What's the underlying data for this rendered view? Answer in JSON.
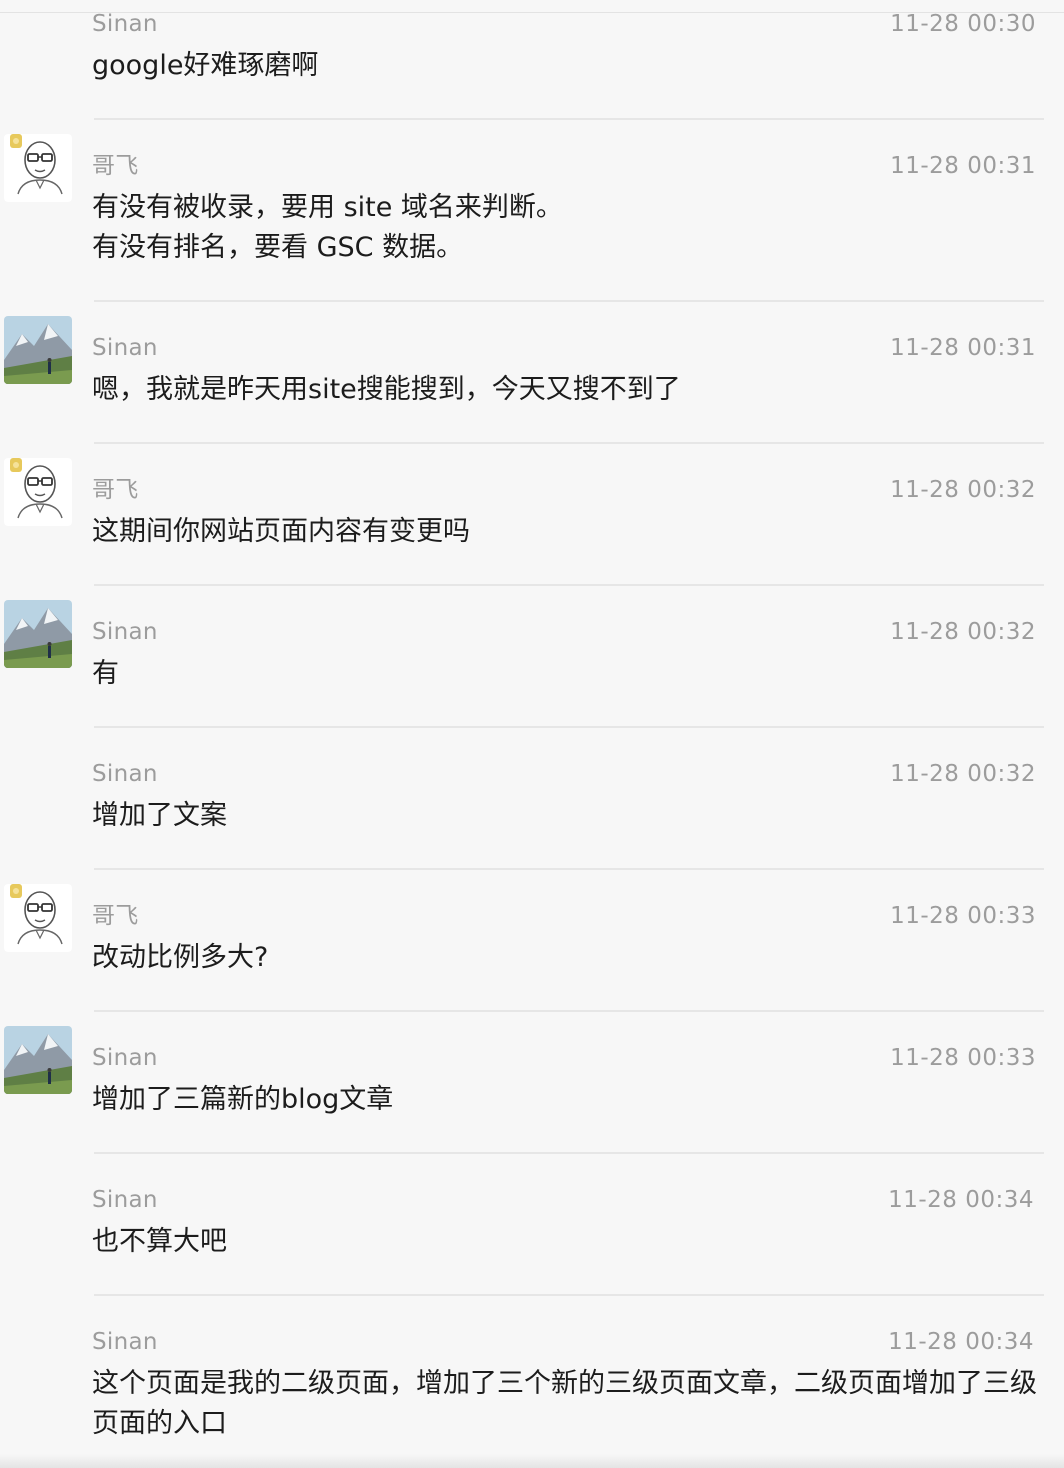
{
  "messages": [
    {
      "sender": "Sinan",
      "time": "11-28 00:30",
      "text": "google好难琢磨啊",
      "avatar": "none"
    },
    {
      "sender": "哥飞",
      "time": "11-28 00:31",
      "text": "有没有被收录，要用 site 域名来判断。\n有没有排名，要看 GSC 数据。",
      "avatar": "cartoon-face-icon"
    },
    {
      "sender": "Sinan",
      "time": "11-28 00:31",
      "text": "嗯，我就是昨天用site搜能搜到，今天又搜不到了",
      "avatar": "mountain-photo-icon"
    },
    {
      "sender": "哥飞",
      "time": "11-28 00:32",
      "text": "这期间你网站页面内容有变更吗",
      "avatar": "cartoon-face-icon"
    },
    {
      "sender": "Sinan",
      "time": "11-28 00:32",
      "text": "有",
      "avatar": "mountain-photo-icon"
    },
    {
      "sender": "Sinan",
      "time": "11-28 00:32",
      "text": "增加了文案",
      "avatar": "none"
    },
    {
      "sender": "哥飞",
      "time": "11-28 00:33",
      "text": "改动比例多大?",
      "avatar": "cartoon-face-icon"
    },
    {
      "sender": "Sinan",
      "time": "11-28 00:33",
      "text": "增加了三篇新的blog文章",
      "avatar": "mountain-photo-icon"
    },
    {
      "sender": "Sinan",
      "time": "11-28 00:34",
      "text": "也不算大吧",
      "avatar": "none"
    },
    {
      "sender": "Sinan",
      "time": "11-28 00:34",
      "text": "这个页面是我的二级页面，增加了三个新的三级页面文章，二级页面增加了三级页面的入口",
      "avatar": "none"
    }
  ],
  "colors": {
    "background": "#f7f7f7",
    "meta_text": "#9c9c9c",
    "body_text": "#1c1c1c",
    "divider": "#e6e6e6"
  }
}
